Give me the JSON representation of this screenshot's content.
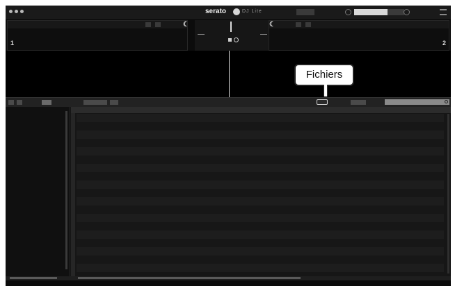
{
  "app": {
    "brand": "serato",
    "product": "DJ Lite"
  },
  "callout": {
    "label": "Fichiers"
  },
  "icons": {
    "window_controls": "traffic-light-dots",
    "brand_logo": "serato-logo-icon",
    "mixer_toggle": "mixer-icon",
    "search": "search-icon",
    "menu": "menu-icon"
  },
  "decks": {
    "left": {
      "number": "1"
    },
    "right": {
      "number": "2"
    }
  },
  "colors": {
    "background": "#121212",
    "waveform": "#000000",
    "callout_border": "#222222"
  }
}
